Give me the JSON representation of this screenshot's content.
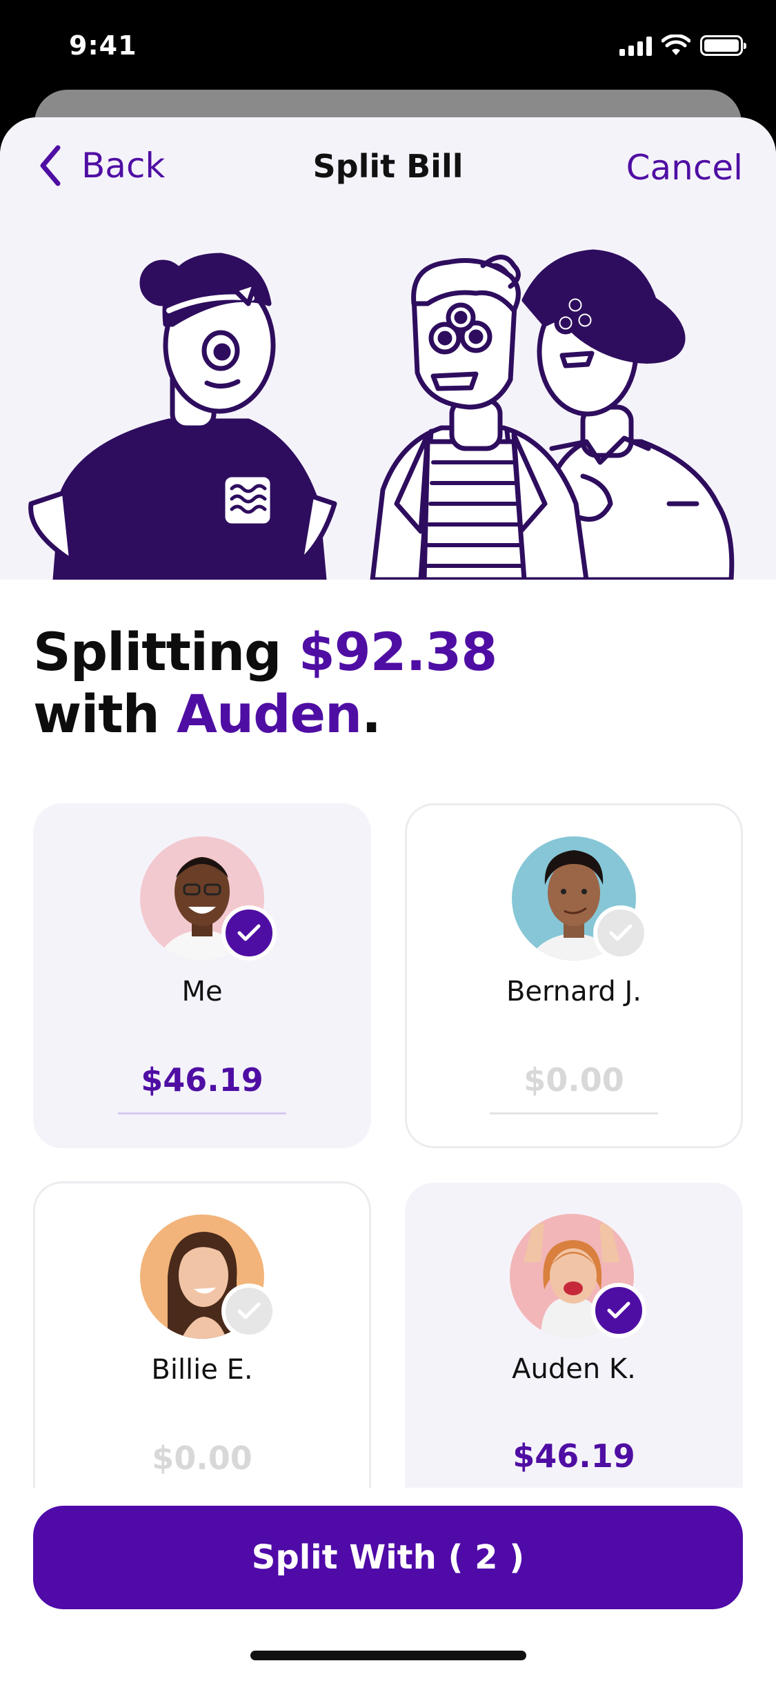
{
  "status_bar": {
    "time": "9:41",
    "icons": [
      "signal-icon",
      "wifi-icon",
      "battery-icon"
    ]
  },
  "nav": {
    "back_label": "Back",
    "title": "Split Bill",
    "cancel_label": "Cancel"
  },
  "headline": {
    "prefix": "Splitting ",
    "amount": "$92.38",
    "mid": "with ",
    "name": "Auden",
    "suffix": "."
  },
  "people": [
    {
      "name": "Me",
      "amount": "$46.19",
      "selected": true
    },
    {
      "name": "Bernard J.",
      "amount": "$0.00",
      "selected": false
    },
    {
      "name": "Billie E.",
      "amount": "$0.00",
      "selected": false
    },
    {
      "name": "Auden K.",
      "amount": "$46.19",
      "selected": true
    }
  ],
  "cta": {
    "label": "Split With ( 2 )"
  },
  "colors": {
    "accent": "#4f0ea3",
    "hero_bg": "#f5f3fa",
    "selected_card": "#f5f3fa",
    "illustration": "#2e0d5e"
  }
}
